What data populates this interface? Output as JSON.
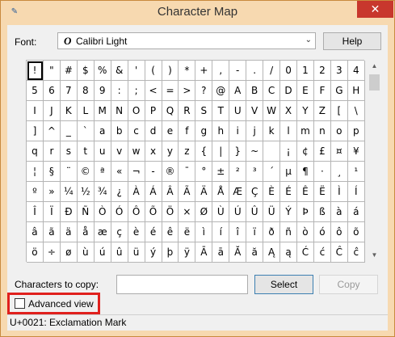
{
  "window": {
    "title": "Character Map",
    "close_glyph": "✕",
    "app_glyph": "✎"
  },
  "font": {
    "label": "Font:",
    "glyph": "O",
    "value": "Calibri Light",
    "chevron": "⌄"
  },
  "help_label": "Help",
  "characters": [
    "!",
    "\"",
    "#",
    "$",
    "%",
    "&",
    "'",
    "(",
    ")",
    "*",
    "+",
    ",",
    "-",
    ".",
    "/",
    "0",
    "1",
    "2",
    "3",
    "4",
    "5",
    "6",
    "7",
    "8",
    "9",
    ":",
    ";",
    "<",
    "=",
    ">",
    "?",
    "@",
    "A",
    "B",
    "C",
    "D",
    "E",
    "F",
    "G",
    "H",
    "I",
    "J",
    "K",
    "L",
    "M",
    "N",
    "O",
    "P",
    "Q",
    "R",
    "S",
    "T",
    "U",
    "V",
    "W",
    "X",
    "Y",
    "Z",
    "[",
    "\\",
    "]",
    "^",
    "_",
    "`",
    "a",
    "b",
    "c",
    "d",
    "e",
    "f",
    "g",
    "h",
    "i",
    "j",
    "k",
    "l",
    "m",
    "n",
    "o",
    "p",
    "q",
    "r",
    "s",
    "t",
    "u",
    "v",
    "w",
    "x",
    "y",
    "z",
    "{",
    "|",
    "}",
    "~",
    "",
    "¡",
    "¢",
    "£",
    "¤",
    "¥",
    "¦",
    "§",
    "¨",
    "©",
    "ª",
    "«",
    "¬",
    "-",
    "®",
    "¯",
    "°",
    "±",
    "²",
    "³",
    "´",
    "µ",
    "¶",
    "·",
    "¸",
    "¹",
    "º",
    "»",
    "¼",
    "½",
    "¾",
    "¿",
    "À",
    "Á",
    "Â",
    "Ã",
    "Ä",
    "Å",
    "Æ",
    "Ç",
    "È",
    "É",
    "Ê",
    "Ë",
    "Ì",
    "Í",
    "Î",
    "Ï",
    "Ð",
    "Ñ",
    "Ò",
    "Ó",
    "Ô",
    "Õ",
    "Ö",
    "×",
    "Ø",
    "Ù",
    "Ú",
    "Û",
    "Ü",
    "Ý",
    "Þ",
    "ß",
    "à",
    "á",
    "â",
    "ã",
    "ä",
    "å",
    "æ",
    "ç",
    "è",
    "é",
    "ê",
    "ë",
    "ì",
    "í",
    "î",
    "ï",
    "ð",
    "ñ",
    "ò",
    "ó",
    "ô",
    "õ",
    "ö",
    "÷",
    "ø",
    "ù",
    "ú",
    "û",
    "ü",
    "ý",
    "þ",
    "ÿ",
    "Ā",
    "ā",
    "Ă",
    "ă",
    "Ą",
    "ą",
    "Ć",
    "ć",
    "Ĉ",
    "ĉ"
  ],
  "scroll": {
    "up_glyph": "▲",
    "down_glyph": "▼"
  },
  "copy": {
    "label": "Characters to copy:",
    "value": "",
    "select_label": "Select",
    "copy_label": "Copy"
  },
  "advanced_view": {
    "label": "Advanced view",
    "checked": false
  },
  "status": "U+0021: Exclamation Mark",
  "colors": {
    "titlebar": "#f7d9b0",
    "close": "#c8372d",
    "highlight": "#e0201d"
  }
}
